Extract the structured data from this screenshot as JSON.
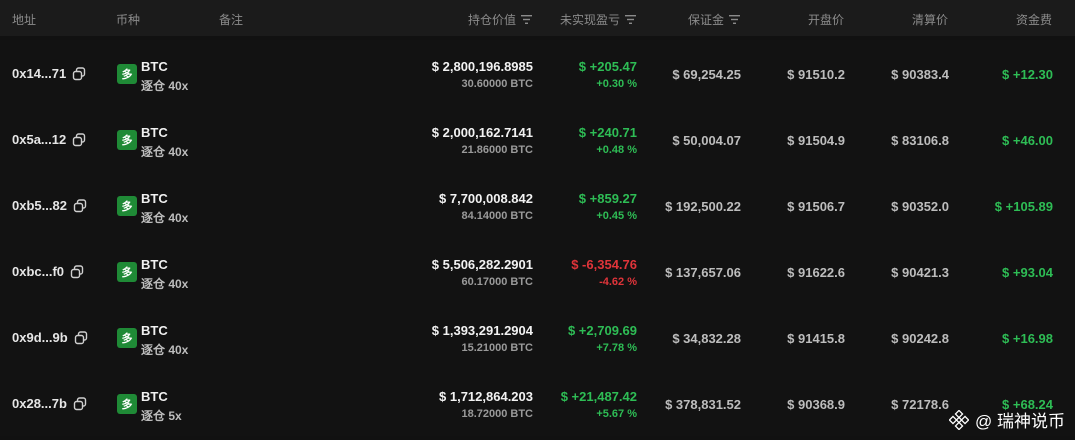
{
  "header": {
    "address": "地址",
    "coin": "币种",
    "note": "备注",
    "position_value": "持仓价值",
    "unrealized_pnl": "未实现盈亏",
    "margin": "保证金",
    "open_price": "开盘价",
    "liq_price": "清算价",
    "funding": "资金费"
  },
  "rows": [
    {
      "address": "0x14...71",
      "coin_badge": "多",
      "coin": "BTC",
      "leverage": "逐仓 40x",
      "value": "$ 2,800,196.8985",
      "amount": "30.60000 BTC",
      "pnl": "$ +205.47",
      "pnl_pct": "+0.30 %",
      "pnl_sign": "pos",
      "margin": "$ 69,254.25",
      "open_price": "$ 91510.2",
      "liq_price": "$ 90383.4",
      "funding": "$ +12.30"
    },
    {
      "address": "0x5a...12",
      "coin_badge": "多",
      "coin": "BTC",
      "leverage": "逐仓 40x",
      "value": "$ 2,000,162.7141",
      "amount": "21.86000 BTC",
      "pnl": "$ +240.71",
      "pnl_pct": "+0.48 %",
      "pnl_sign": "pos",
      "margin": "$ 50,004.07",
      "open_price": "$ 91504.9",
      "liq_price": "$ 83106.8",
      "funding": "$ +46.00"
    },
    {
      "address": "0xb5...82",
      "coin_badge": "多",
      "coin": "BTC",
      "leverage": "逐仓 40x",
      "value": "$ 7,700,008.842",
      "amount": "84.14000 BTC",
      "pnl": "$ +859.27",
      "pnl_pct": "+0.45 %",
      "pnl_sign": "pos",
      "margin": "$ 192,500.22",
      "open_price": "$ 91506.7",
      "liq_price": "$ 90352.0",
      "funding": "$ +105.89"
    },
    {
      "address": "0xbc...f0",
      "coin_badge": "多",
      "coin": "BTC",
      "leverage": "逐仓 40x",
      "value": "$ 5,506,282.2901",
      "amount": "60.17000 BTC",
      "pnl": "$ -6,354.76",
      "pnl_pct": "-4.62 %",
      "pnl_sign": "neg",
      "margin": "$ 137,657.06",
      "open_price": "$ 91622.6",
      "liq_price": "$ 90421.3",
      "funding": "$ +93.04"
    },
    {
      "address": "0x9d...9b",
      "coin_badge": "多",
      "coin": "BTC",
      "leverage": "逐仓 40x",
      "value": "$ 1,393,291.2904",
      "amount": "15.21000 BTC",
      "pnl": "$ +2,709.69",
      "pnl_pct": "+7.78 %",
      "pnl_sign": "pos",
      "margin": "$ 34,832.28",
      "open_price": "$ 91415.8",
      "liq_price": "$ 90242.8",
      "funding": "$ +16.98"
    },
    {
      "address": "0x28...7b",
      "coin_badge": "多",
      "coin": "BTC",
      "leverage": "逐仓 5x",
      "value": "$ 1,712,864.203",
      "amount": "18.72000 BTC",
      "pnl": "$ +21,487.42",
      "pnl_pct": "+5.67 %",
      "pnl_sign": "pos",
      "margin": "$ 378,831.52",
      "open_price": "$ 90368.9",
      "liq_price": "$ 72178.6",
      "funding": "$ +68.24"
    }
  ],
  "watermark": {
    "text": "@ 瑞神说币",
    "icon": "binance-logo-icon"
  },
  "colors": {
    "positive": "#2ebd55",
    "negative": "#e0343a",
    "long_badge": "#1f8a36",
    "background": "#111111"
  }
}
